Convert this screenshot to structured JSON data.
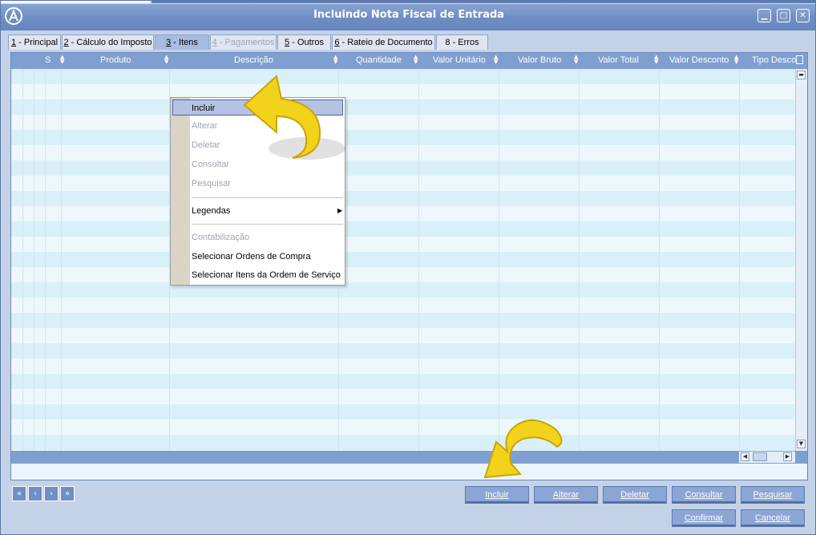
{
  "window": {
    "title": "Incluindo Nota Fiscal de Entrada",
    "controls": [
      "▁",
      "□",
      "✕"
    ]
  },
  "tabs": [
    {
      "key": "1",
      "label": " - Principal",
      "state": "normal"
    },
    {
      "key": "2",
      "label": " - Cálculo do Imposto",
      "state": "normal"
    },
    {
      "key": "3",
      "label": " - Itens",
      "state": "active"
    },
    {
      "key": "4",
      "label": " - Pagamentos",
      "state": "disabled"
    },
    {
      "key": "5",
      "label": " - Outros",
      "state": "normal"
    },
    {
      "key": "6",
      "label": " - Rateio de Documento",
      "state": "normal"
    },
    {
      "key": "8",
      "label": " - Erros",
      "state": "normal"
    }
  ],
  "grid": {
    "columns": [
      "S",
      "Produto",
      "Descrição",
      "Quantidade",
      "Valor Unitário",
      "Valor Bruto",
      "Valor Total",
      "Valor Desconto",
      "Tipo Desco"
    ]
  },
  "context_menu": {
    "items": [
      {
        "label": "Incluir",
        "state": "selected"
      },
      {
        "label": "Alterar",
        "state": "disabled"
      },
      {
        "label": "Deletar",
        "state": "disabled"
      },
      {
        "label": "Consultar",
        "state": "disabled"
      },
      {
        "label": "Pesquisar",
        "state": "disabled"
      },
      {
        "label": "Legendas",
        "state": "submenu"
      },
      {
        "label": "Contabilização",
        "state": "disabled"
      },
      {
        "label": "Selecionar Ordens de Compra",
        "state": "normal"
      },
      {
        "label": "Selecionar Itens da Ordem de Serviço",
        "state": "normal"
      }
    ]
  },
  "nav_buttons": [
    "«",
    "‹",
    "›",
    "»"
  ],
  "actions": {
    "incluir": "Incluir",
    "alterar": "Alterar",
    "deletar": "Deletar",
    "consultar": "Consultar",
    "pesquisar": "Pesquisar",
    "confirmar": "Confirmar",
    "cancelar": "Cancelar"
  },
  "colors": {
    "titlebar": "#7292c8",
    "grid_header": "#7f9fd1",
    "row_alt": "#d9f0f8",
    "highlight_arrow": "#f2d21a"
  }
}
